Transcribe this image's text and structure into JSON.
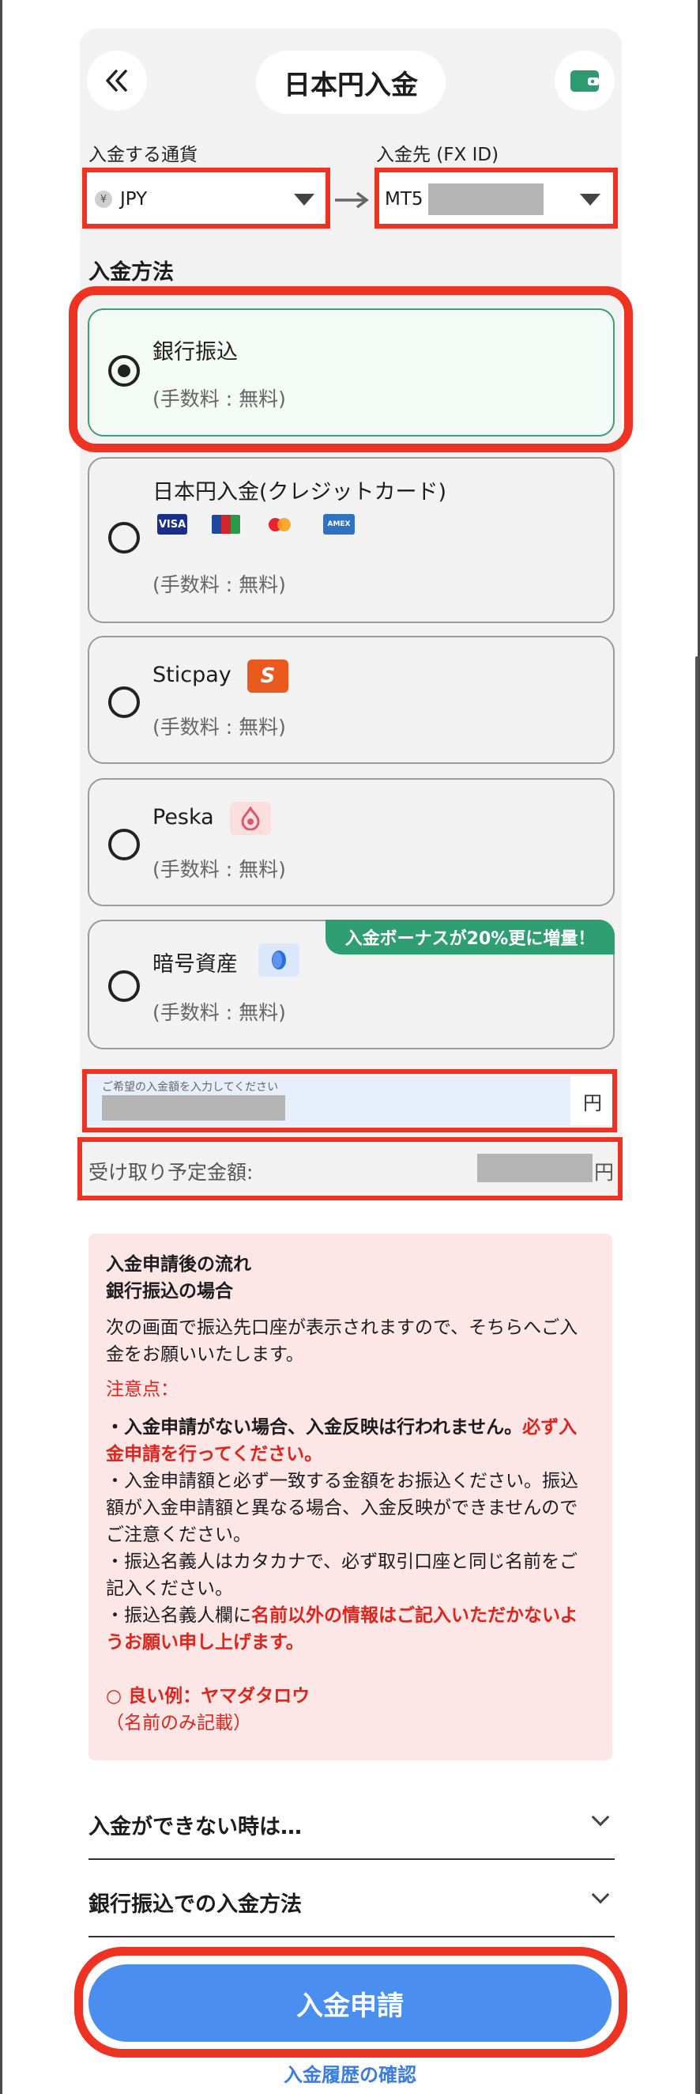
{
  "header": {
    "title": "日本円入金",
    "back_icon": "double-chevron-left-icon",
    "wallet_icon": "wallet-icon"
  },
  "currency": {
    "label": "入金する通貨",
    "selected": "JPY",
    "icon": "yen-coin-icon"
  },
  "destination": {
    "label": "入金先 (FX ID)",
    "selected_prefix": "MT5"
  },
  "methods": {
    "section_title": "入金方法",
    "items": [
      {
        "name": "銀行振込",
        "fee": "(手数料 : 無料)",
        "selected": true
      },
      {
        "name": "日本円入金(クレジットカード)",
        "fee": "(手数料 : 無料)",
        "selected": false,
        "card_logos": [
          "VISA",
          "JCB",
          "mastercard",
          "AMEX"
        ]
      },
      {
        "name": "Sticpay",
        "fee": "(手数料 : 無料)",
        "selected": false,
        "logo_text": "S"
      },
      {
        "name": "Peska",
        "fee": "(手数料 : 無料)",
        "selected": false
      },
      {
        "name": "暗号資産",
        "fee": "(手数料 : 無料)",
        "selected": false,
        "badge": "入金ボーナスが20%更に増量！"
      }
    ]
  },
  "amount": {
    "placeholder": "ご希望の入金額を入力してください",
    "unit": "円"
  },
  "receive": {
    "label": "受け取り予定金額:",
    "unit": "円"
  },
  "notice": {
    "title_line1": "入金申請後の流れ",
    "title_line2": "銀行振込の場合",
    "intro": "次の画面で振込先口座が表示されますので、そちらへご入金をお願いいたします。",
    "caution_label": "注意点：",
    "bullet1_a": "・入金申請がない場合、入金反映は行われません。",
    "bullet1_b": "必ず入金申請を行ってください。",
    "bullet2": "・入金申請額と必ず一致する金額をお振込ください。振込額が入金申請額と異なる場合、入金反映ができませんのでご注意ください。",
    "bullet3": "・振込名義人はカタカナで、必ず取引口座と同じ名前をご記入ください。",
    "bullet4_a": "・振込名義人欄に",
    "bullet4_b": "名前以外の情報はご記入いただかないようお願い申し上げます。",
    "example": "○ 良い例：ヤマダタロウ",
    "example_note": "（名前のみ記載）"
  },
  "accordions": [
    {
      "title": "入金ができない時は…"
    },
    {
      "title": "銀行振込での入金方法"
    }
  ],
  "submit_label": "入金申請",
  "history_link": "入金履歴の確認",
  "colors": {
    "highlight_red": "#ee3323",
    "selected_green": "#3c9e74",
    "submit_blue": "#4a8ff0",
    "notice_bg": "#fde6e6",
    "warning_red": "#e0231b"
  }
}
